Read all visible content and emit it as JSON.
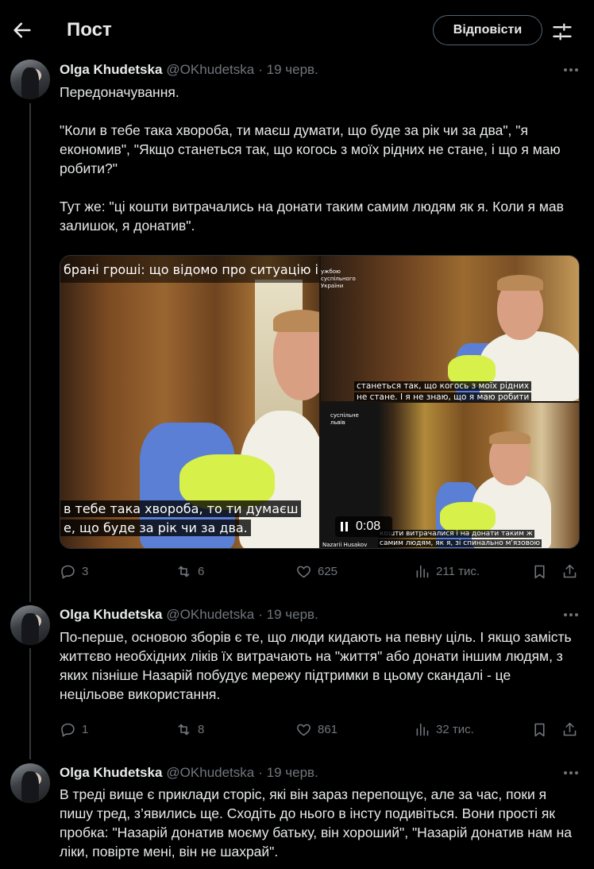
{
  "header": {
    "title": "Пост",
    "reply_button": "Відповісти"
  },
  "tweets": [
    {
      "name": "Olga Khudetska",
      "handle": "@OKhudetska",
      "date": "· 19 черв.",
      "paragraphs": [
        "Передоначування.",
        "\"Коли в тебе така хвороба, ти маєш думати, що буде за рік чи за два\", \"я економив\", \"Якщо станеться так, що когось з моїх рідних не стане, і що я маю робити?\"",
        "Тут же: \"ці кошти витрачались на донати таким самим людям як я. Коли я мав залишок, я донатив\"."
      ],
      "media": {
        "left_top_text": "брані гроші: що відомо про ситуацію із",
        "left_subtitle_1": "в тебе така хвороба, то ти думаєш",
        "left_subtitle_2": "е, що буде за рік чи за два.",
        "right_top_brand": "ужбою суспільного України",
        "right_top_subtitle_1": "станеться так, що когось з моїх рідних",
        "right_top_subtitle_2": "не стане. І я не знаю, що я маю робити",
        "right_bottom_brand": "суспільне львів",
        "right_bottom_credit": "Nazarii Husakov",
        "right_bottom_subtitle_1": "кошти витрачалися і на донати таким ж",
        "right_bottom_subtitle_2": "самим людям, як я, зі спинально м'язовою",
        "video_time": "0:08"
      },
      "stats": {
        "replies": "3",
        "reposts": "6",
        "likes": "625",
        "views": "211 тис."
      }
    },
    {
      "name": "Olga Khudetska",
      "handle": "@OKhudetska",
      "date": "· 19 черв.",
      "paragraphs": [
        "По-перше, основою зборів є те, що люди кидають на певну ціль. І якщо замість життєво необхідних ліків їх витрачають на \"життя\" або донати іншим людям, з яких пізніше Назарій побудує мережу підтримки в цьому скандалі - це нецільове використання."
      ],
      "stats": {
        "replies": "1",
        "reposts": "8",
        "likes": "861",
        "views": "32 тис."
      }
    },
    {
      "name": "Olga Khudetska",
      "handle": "@OKhudetska",
      "date": "· 19 черв.",
      "paragraphs": [
        "В треді вище є приклади сторіс, які він зараз перепощує, але за час, поки я пишу тред, з’явились ще. Сходіть до нього в інсту подивіться. Вони прості як пробка: \"Назарій донатив моєму батьку, він хороший\", \"Назарій донатив нам на ліки, повірте мені, він не шахрай\"."
      ]
    }
  ],
  "icons": {
    "back": "arrow-left-icon",
    "tune": "sliders-icon",
    "more": "more-dots-icon",
    "reply": "speech-bubble-icon",
    "repost": "repost-icon",
    "like": "heart-icon",
    "views": "bar-chart-icon",
    "bookmark": "bookmark-icon",
    "share": "share-icon",
    "pause": "pause-icon"
  },
  "colors": {
    "background": "#000000",
    "text": "#e7e9ea",
    "secondary": "#71767b",
    "border": "#536471"
  }
}
